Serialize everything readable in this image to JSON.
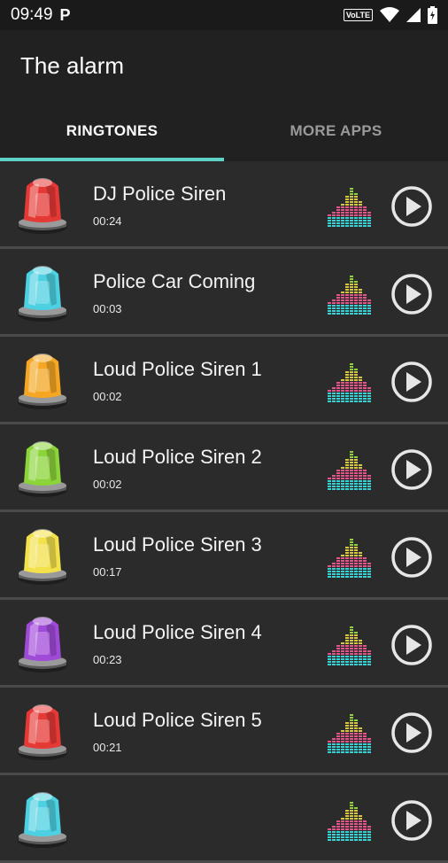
{
  "status": {
    "time": "09:49",
    "app_indicator": "P",
    "network": "VoLTE"
  },
  "app": {
    "title": "The alarm"
  },
  "tabs": [
    {
      "label": "RINGTONES",
      "active": true
    },
    {
      "label": "MORE APPS",
      "active": false
    }
  ],
  "colors": {
    "accent": "#5fd3c6",
    "background": "#2b2b2b",
    "toolbar": "#212121"
  },
  "ringtones": [
    {
      "title": "DJ Police Siren",
      "duration": "00:24",
      "siren_color": "#e53935"
    },
    {
      "title": "Police Car Coming",
      "duration": "00:03",
      "siren_color": "#4dd0e1"
    },
    {
      "title": "Loud Police Siren 1",
      "duration": "00:02",
      "siren_color": "#f5a623"
    },
    {
      "title": "Loud Police Siren 2",
      "duration": "00:02",
      "siren_color": "#8bd43a"
    },
    {
      "title": "Loud Police Siren 3",
      "duration": "00:17",
      "siren_color": "#f2e14b"
    },
    {
      "title": "Loud Police Siren 4",
      "duration": "00:23",
      "siren_color": "#a04ad8"
    },
    {
      "title": "Loud Police Siren 5",
      "duration": "00:21",
      "siren_color": "#e53935"
    },
    {
      "title": "",
      "duration": "",
      "siren_color": "#4dd0e1"
    }
  ]
}
